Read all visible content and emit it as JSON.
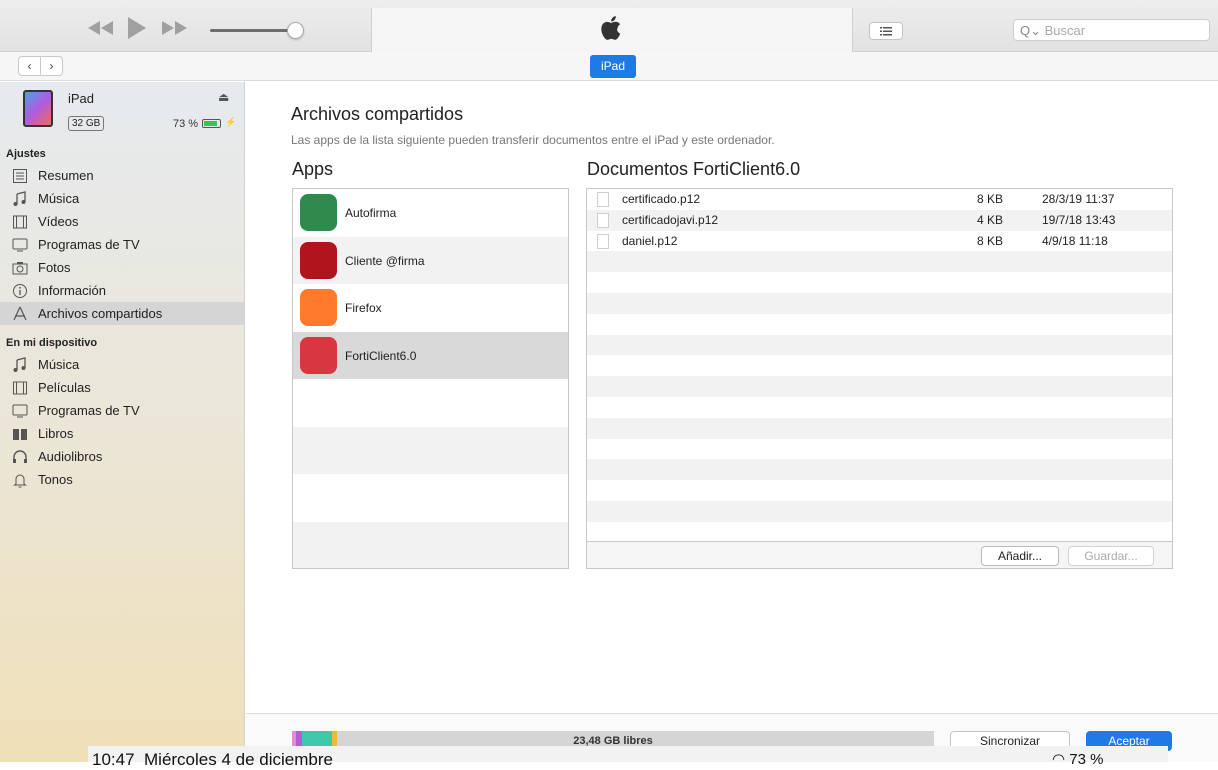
{
  "search": {
    "placeholder": "Buscar"
  },
  "subbar": {
    "device_tab": "iPad"
  },
  "device": {
    "name": "iPad",
    "capacity": "32 GB",
    "battery": "73 %"
  },
  "sidebar": {
    "section1": "Ajustes",
    "settings": [
      {
        "label": "Resumen",
        "icon": "summary-icon"
      },
      {
        "label": "Música",
        "icon": "music-icon"
      },
      {
        "label": "Vídeos",
        "icon": "video-icon"
      },
      {
        "label": "Programas de TV",
        "icon": "tv-icon"
      },
      {
        "label": "Fotos",
        "icon": "camera-icon"
      },
      {
        "label": "Información",
        "icon": "info-icon"
      },
      {
        "label": "Archivos compartidos",
        "icon": "apps-icon"
      }
    ],
    "section2": "En mi dispositivo",
    "device_items": [
      {
        "label": "Música",
        "icon": "music-icon"
      },
      {
        "label": "Películas",
        "icon": "film-icon"
      },
      {
        "label": "Programas de TV",
        "icon": "tv-icon"
      },
      {
        "label": "Libros",
        "icon": "book-icon"
      },
      {
        "label": "Audiolibros",
        "icon": "headphones-icon"
      },
      {
        "label": "Tonos",
        "icon": "bell-icon"
      }
    ]
  },
  "main": {
    "title": "Archivos compartidos",
    "subtitle": "Las apps de la lista siguiente pueden transferir documentos entre el iPad y este ordenador.",
    "apps_title": "Apps",
    "docs_title": "Documentos FortiClient6.0",
    "apps": [
      {
        "label": "Autofirma",
        "color": "#2f8a4e"
      },
      {
        "label": "Cliente @firma",
        "color": "#b0151d"
      },
      {
        "label": "Firefox",
        "color": "#ff7a2d"
      },
      {
        "label": "FortiClient6.0",
        "color": "#d9373f"
      }
    ],
    "documents": [
      {
        "name": "certificado.p12",
        "size": "8 KB",
        "date": "28/3/19 11:37"
      },
      {
        "name": "certificadojavi.p12",
        "size": "4 KB",
        "date": "19/7/18 13:43"
      },
      {
        "name": "daniel.p12",
        "size": "8 KB",
        "date": "4/9/18 11:18"
      }
    ],
    "add_button": "Añadir...",
    "save_button": "Guardar..."
  },
  "bottom": {
    "free_space": "23,48 GB libres",
    "sync_button": "Sincronizar",
    "ok_button": "Aceptar"
  },
  "ipad_status": {
    "time": "10:47",
    "date": "Miércoles 4 de diciembre",
    "battery": "73 %"
  }
}
